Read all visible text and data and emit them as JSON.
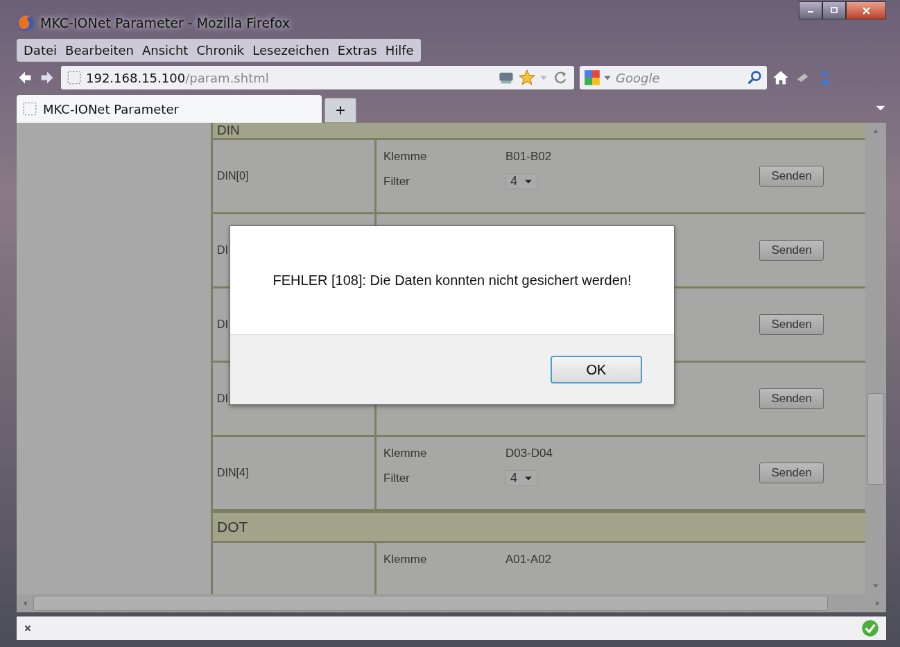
{
  "window": {
    "title": "MKC-IONet Parameter - Mozilla Firefox"
  },
  "menu": [
    "Datei",
    "Bearbeiten",
    "Ansicht",
    "Chronik",
    "Lesezeichen",
    "Extras",
    "Hilfe"
  ],
  "address": {
    "host": "192.168.15.100",
    "path": "/param.shtml"
  },
  "search": {
    "placeholder": "Google"
  },
  "tabs": [
    {
      "title": "MKC-IONet Parameter",
      "selected": true
    }
  ],
  "new_tab": "+",
  "sections": [
    {
      "title": "DIN",
      "rows": [
        {
          "label": "DIN[0]",
          "fields": [
            {
              "kind": "text",
              "label": "Klemme",
              "value": "B01-B02"
            },
            {
              "kind": "select",
              "label": "Filter",
              "value": "4"
            }
          ],
          "button": "Senden"
        },
        {
          "label": "DI",
          "fields": [],
          "button": "Senden"
        },
        {
          "label": "DI",
          "fields": [],
          "button": "Senden"
        },
        {
          "label": "DI",
          "fields": [],
          "button": "Senden"
        },
        {
          "label": "DIN[4]",
          "fields": [
            {
              "kind": "text",
              "label": "Klemme",
              "value": "D03-D04"
            },
            {
              "kind": "select",
              "label": "Filter",
              "value": "4"
            }
          ],
          "button": "Senden"
        }
      ]
    },
    {
      "title": "DOT",
      "rows": [
        {
          "label": "",
          "fields": [
            {
              "kind": "text",
              "label": "Klemme",
              "value": "A01-A02"
            }
          ]
        }
      ]
    }
  ],
  "dialog": {
    "message": "FEHLER [108]: Die Daten konnten nicht gesichert werden!",
    "button": "OK"
  }
}
